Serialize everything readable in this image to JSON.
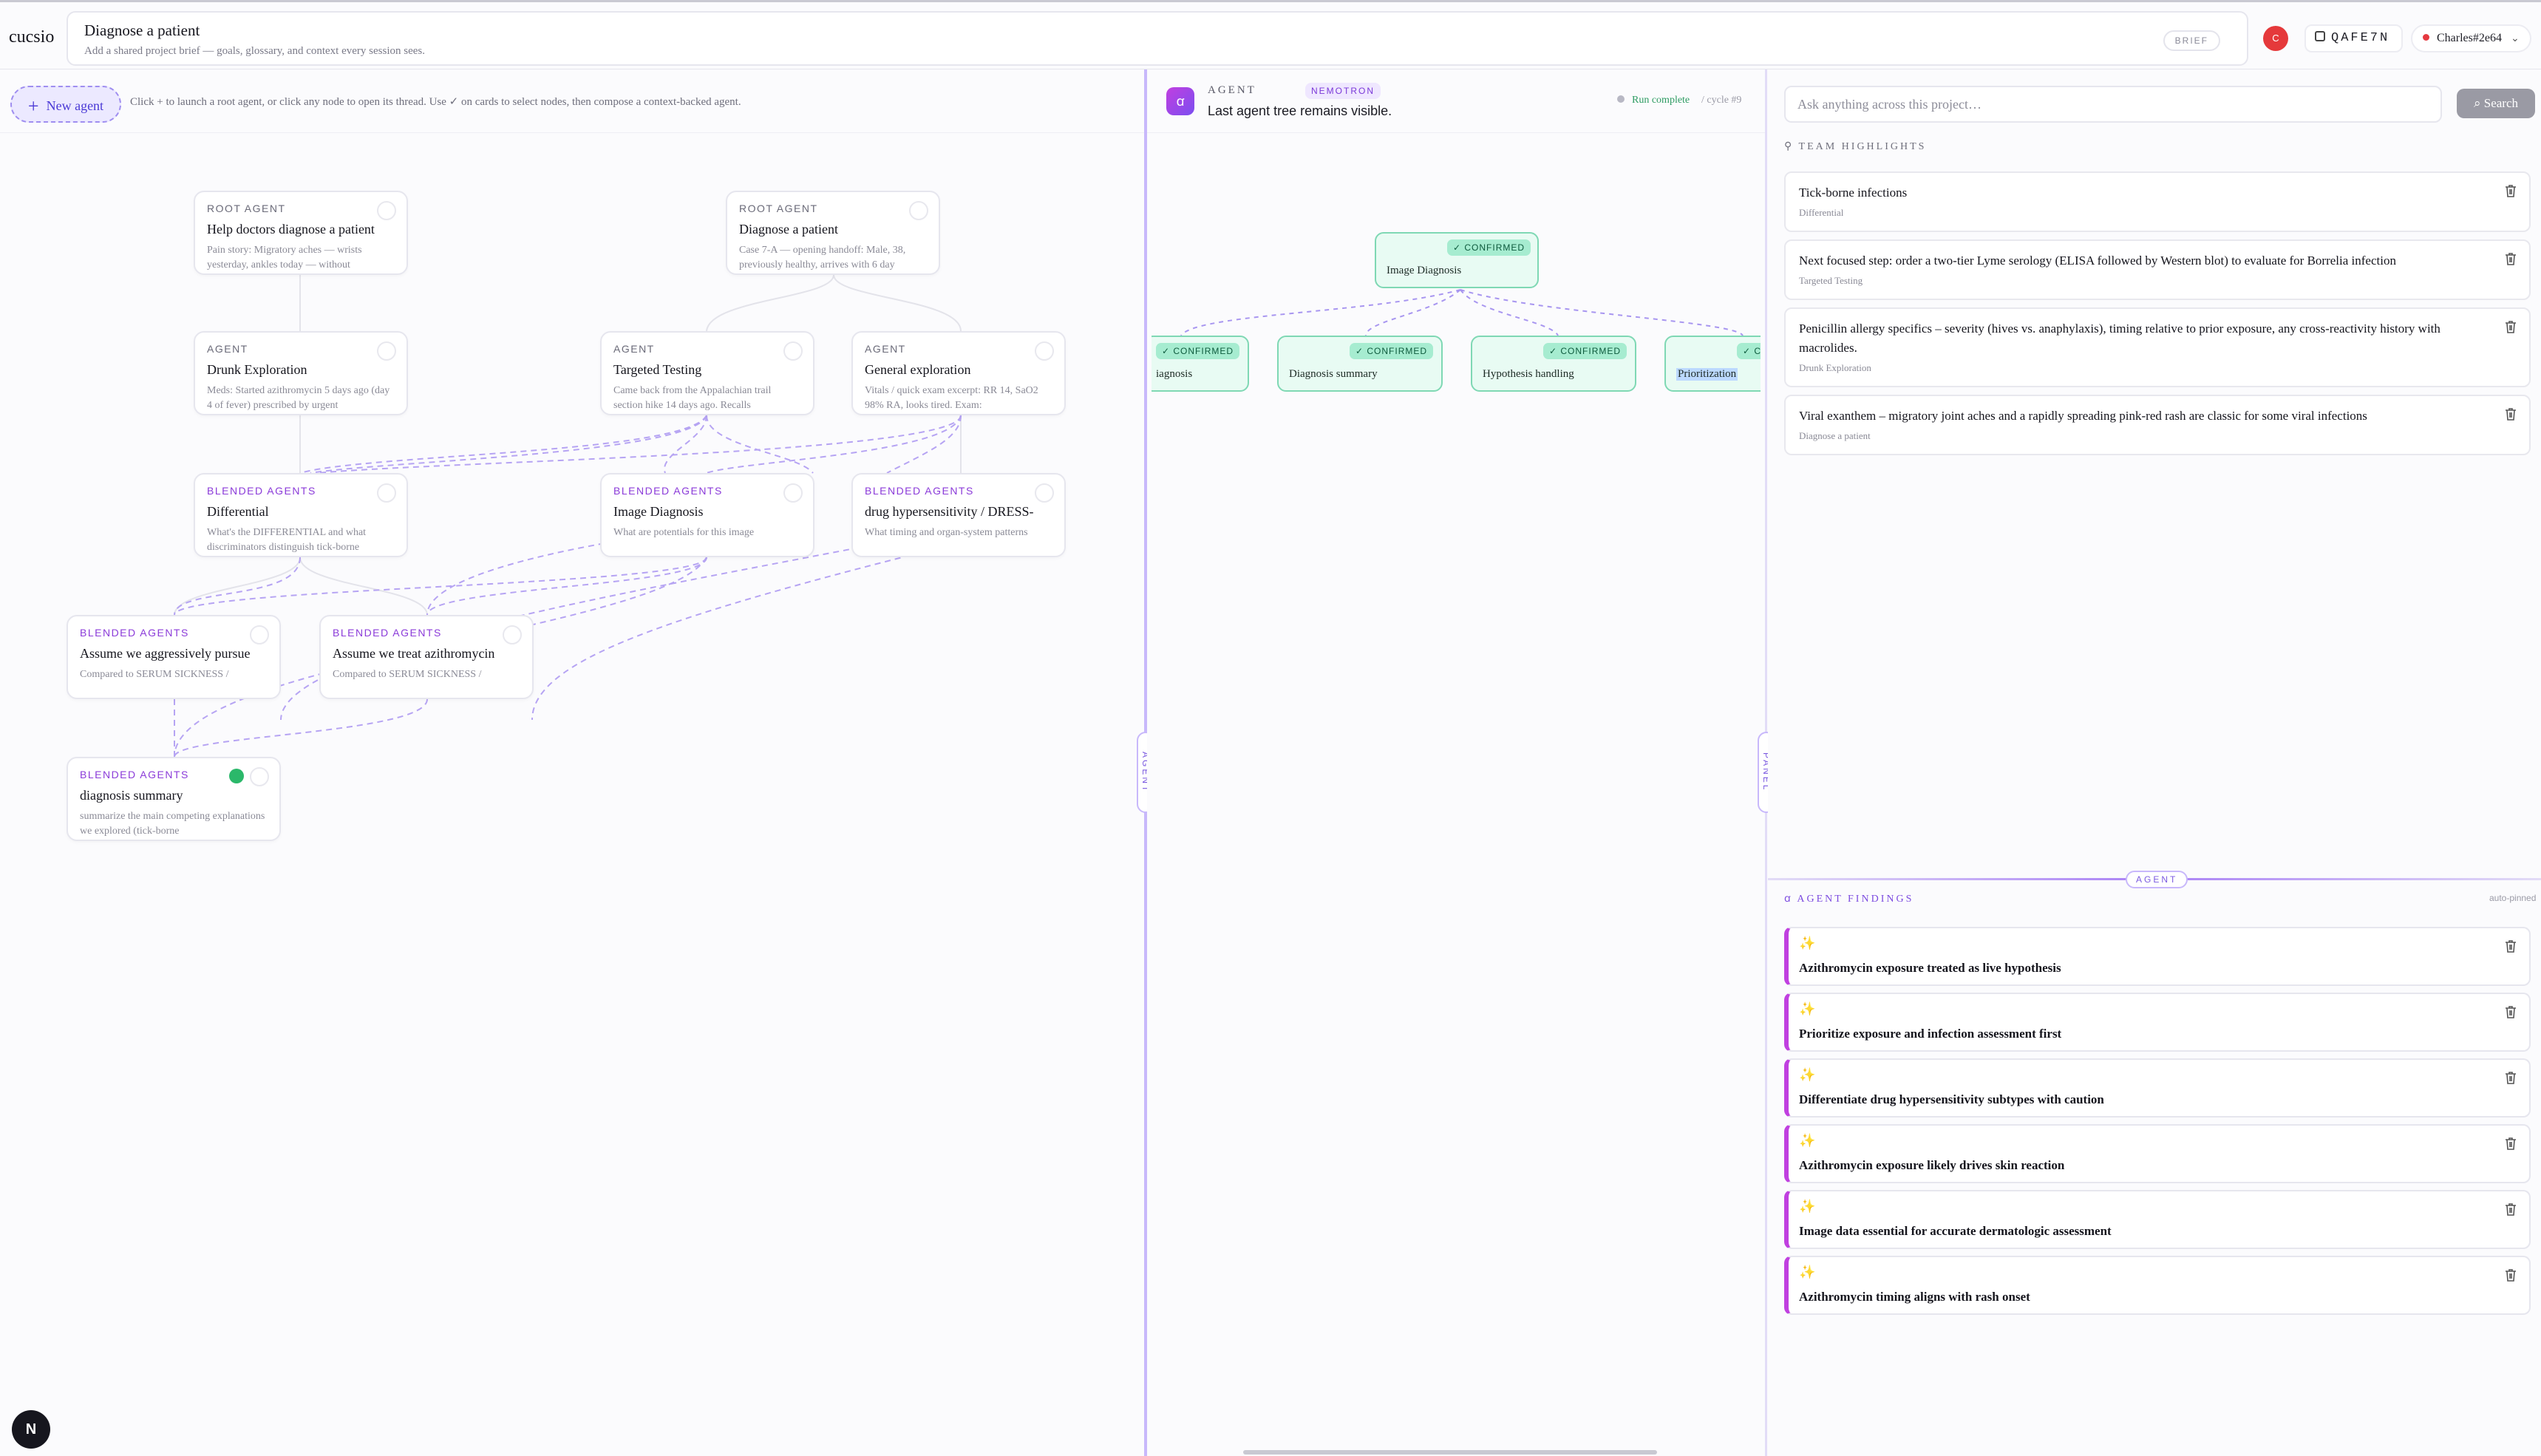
{
  "app": {
    "logo": "cucsio"
  },
  "brief": {
    "title": "Diagnose a patient",
    "subtitle": "Add a shared project brief — goals, glossary, and context every session sees.",
    "tag": "BRIEF"
  },
  "session": {
    "avatar_letter": "C",
    "code": "QAFE7N",
    "user": "Charles#2e64"
  },
  "canvas": {
    "new_agent_label": "New agent",
    "hint": "Click + to launch a root agent, or click any node to open its thread. Use ✓ on cards to select nodes, then compose a context-backed agent.",
    "nodes": [
      {
        "kind": "ROOT AGENT",
        "title": "Help doctors diagnose a patient",
        "desc": "Pain story: Migratory aches — wrists yesterday, ankles today — without"
      },
      {
        "kind": "ROOT AGENT",
        "title": "Diagnose a patient",
        "desc": "Case 7-A — opening handoff: Male, 38, previously healthy, arrives with 6 day"
      },
      {
        "kind": "AGENT",
        "title": "Drunk Exploration",
        "desc": "Meds: Started azithromycin 5 days ago (day 4 of fever) prescribed by urgent"
      },
      {
        "kind": "AGENT",
        "title": "Targeted Testing",
        "desc": "Came back from the Appalachian trail section hike 14 days ago. Recalls"
      },
      {
        "kind": "AGENT",
        "title": "General exploration",
        "desc": "Vitals / quick exam excerpt: RR 14, SaO2 98% RA, looks tired. Exam:"
      },
      {
        "kind": "BLENDED AGENTS",
        "title": "Differential",
        "desc": "What's the DIFFERENTIAL and what discriminators distinguish tick-borne"
      },
      {
        "kind": "BLENDED AGENTS",
        "title": "Image Diagnosis",
        "desc": "What are potentials for this image"
      },
      {
        "kind": "BLENDED AGENTS",
        "title": "drug hypersensitivity / DRESS-",
        "desc": "What timing and organ-system patterns"
      },
      {
        "kind": "BLENDED AGENTS",
        "title": "Assume we aggressively pursue",
        "desc": "Compared to SERUM SICKNESS /"
      },
      {
        "kind": "BLENDED AGENTS",
        "title": "Assume we treat azithromycin",
        "desc": "Compared to SERUM SICKNESS /"
      },
      {
        "kind": "BLENDED AGENTS",
        "title": "diagnosis summary",
        "desc": "summarize the main competing explanations we explored (tick-borne"
      }
    ],
    "bottom_button": "N"
  },
  "dividers": {
    "left_tab": "AGENT",
    "right_tab": "PANEL"
  },
  "agent_pane": {
    "label": "AGENT",
    "model": "NEMOTRON",
    "status_text": "Last agent tree remains visible.",
    "run_status": "Run complete",
    "cycle": "/ cycle #9",
    "tree": {
      "root": {
        "badge": "✓ CONFIRMED",
        "label": "Image Diagnosis"
      },
      "children": [
        {
          "badge": "✓ CONFIRMED",
          "label": "iagnosis"
        },
        {
          "badge": "✓ CONFIRMED",
          "label": "Diagnosis summary"
        },
        {
          "badge": "✓ CONFIRMED",
          "label": "Hypothesis handling"
        },
        {
          "badge": "✓ C",
          "label": "Prioritization"
        }
      ]
    }
  },
  "panel": {
    "search_placeholder": "Ask anything across this project…",
    "search_button": "Search",
    "highlights_label": "TEAM HIGHLIGHTS",
    "highlights": [
      {
        "text": "Tick-borne infections",
        "source": "Differential"
      },
      {
        "text": "Next focused step: order a two-tier Lyme serology (ELISA followed by Western blot) to evaluate for Borrelia infection",
        "source": "Targeted Testing"
      },
      {
        "text": "Penicillin allergy specifics – severity (hives vs. anaphylaxis), timing relative to prior exposure, any cross-reactivity history with macrolides.",
        "source": "Drunk Exploration"
      },
      {
        "text": "Viral exanthem – migratory joint aches and a rapidly spreading pink-red rash are classic for some viral infections",
        "source": "Diagnose a patient"
      }
    ],
    "agent_sep_tag": "AGENT",
    "findings_label": "AGENT FINDINGS",
    "findings_auto": "auto-pinned",
    "findings": [
      {
        "text": "Azithromycin exposure treated as live hypothesis"
      },
      {
        "text": "Prioritize exposure and infection assessment first"
      },
      {
        "text": "Differentiate drug hypersensitivity subtypes with caution"
      },
      {
        "text": "Azithromycin exposure likely drives skin reaction"
      },
      {
        "text": "Image data essential for accurate dermatologic assessment"
      },
      {
        "text": "Azithromycin timing aligns with rash onset"
      }
    ]
  }
}
